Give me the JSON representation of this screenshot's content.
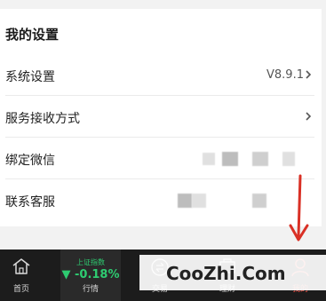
{
  "settings": {
    "section_title": "我的设置",
    "rows": [
      {
        "label": "系统设置",
        "value": "V8.9.1"
      },
      {
        "label": "服务接收方式",
        "value": ""
      },
      {
        "label": "绑定微信",
        "value": ""
      },
      {
        "label": "联系客服",
        "value": ""
      }
    ]
  },
  "bottom_nav": {
    "tabs": [
      {
        "label": "首页",
        "icon": "home-icon"
      },
      {
        "label": "行情",
        "index_name": "上证指数",
        "index_change": "▼ -0.18%"
      },
      {
        "label": "交易",
        "icon": "exchange-icon"
      },
      {
        "label": "理财",
        "icon": "wealth-icon"
      },
      {
        "label": "我的",
        "icon": "user-icon"
      }
    ]
  },
  "watermark": "CooZhi.Com",
  "colors": {
    "accent_red": "#e54d42",
    "index_green": "#2ecc71",
    "nav_background": "#1c1c1c"
  }
}
